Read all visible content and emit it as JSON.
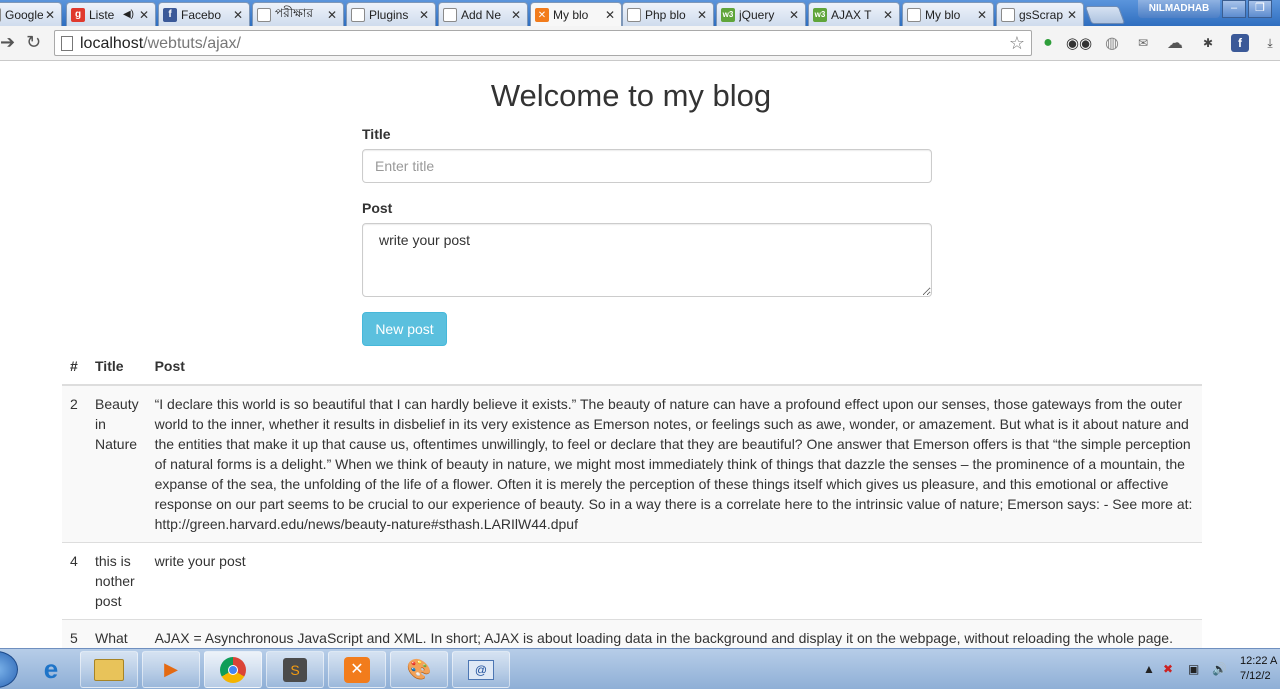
{
  "browser": {
    "tabs": [
      {
        "label": "Google",
        "icon": "google-icon"
      },
      {
        "label": "Liste",
        "icon": "g-icon"
      },
      {
        "label": "Facebo",
        "icon": "facebook-icon"
      },
      {
        "label": "পরীক্ষার",
        "icon": "page-icon"
      },
      {
        "label": "Plugins",
        "icon": "page-icon"
      },
      {
        "label": "Add Ne",
        "icon": "page-icon"
      },
      {
        "label": "My blo",
        "icon": "xampp-icon",
        "active": true
      },
      {
        "label": "Php blo",
        "icon": "page-icon"
      },
      {
        "label": "jQuery",
        "icon": "w3-icon"
      },
      {
        "label": "AJAX T",
        "icon": "w3-icon"
      },
      {
        "label": "My blo",
        "icon": "page-icon"
      },
      {
        "label": "gsScrap",
        "icon": "page-icon"
      }
    ],
    "profile_name": "NILMADHAB",
    "url_host": "localhost",
    "url_path": "/webtuts/ajax/"
  },
  "page": {
    "heading": "Welcome to my blog",
    "form": {
      "title_label": "Title",
      "title_placeholder": "Enter title",
      "post_label": "Post",
      "post_value": "write your post",
      "submit_label": "New post"
    },
    "table": {
      "headers": [
        "#",
        "Title",
        "Post"
      ],
      "rows": [
        {
          "id": "2",
          "title": "Beauty in Nature",
          "post": "“I declare this world is so beautiful that I can hardly believe it exists.” The beauty of nature can have a profound effect upon our senses, those gateways from the outer world to the inner, whether it results in disbelief in its very existence as Emerson notes, or feelings such as awe, wonder, or amazement. But what is it about nature and the entities that make it up that cause us, oftentimes unwillingly, to feel or declare that they are beautiful? One answer that Emerson offers is that “the simple perception of natural forms is a delight.” When we think of beauty in nature, we might most immediately think of things that dazzle the senses – the prominence of a mountain, the expanse of the sea, the unfolding of the life of a flower. Often it is merely the perception of these things itself which gives us pleasure, and this emotional or affective response on our part seems to be crucial to our experience of beauty. So in a way there is a correlate here to the intrinsic value of nature; Emerson says: - See more at: http://green.harvard.edu/news/beauty-nature#sthash.LARIlW44.dpuf"
        },
        {
          "id": "4",
          "title": "this is nother post",
          "post": "write your post"
        },
        {
          "id": "5",
          "title": "What",
          "post": "AJAX = Asynchronous JavaScript and XML. In short; AJAX is about loading data in the background and display it on the webpage, without reloading the whole page."
        }
      ]
    }
  },
  "taskbar": {
    "clock_time": "12:22 A",
    "clock_date": "7/12/2"
  },
  "colors": {
    "button_info": "#5bc0de",
    "tab_strip": "#2f6ebf",
    "taskbar": "#a6c0e2"
  }
}
